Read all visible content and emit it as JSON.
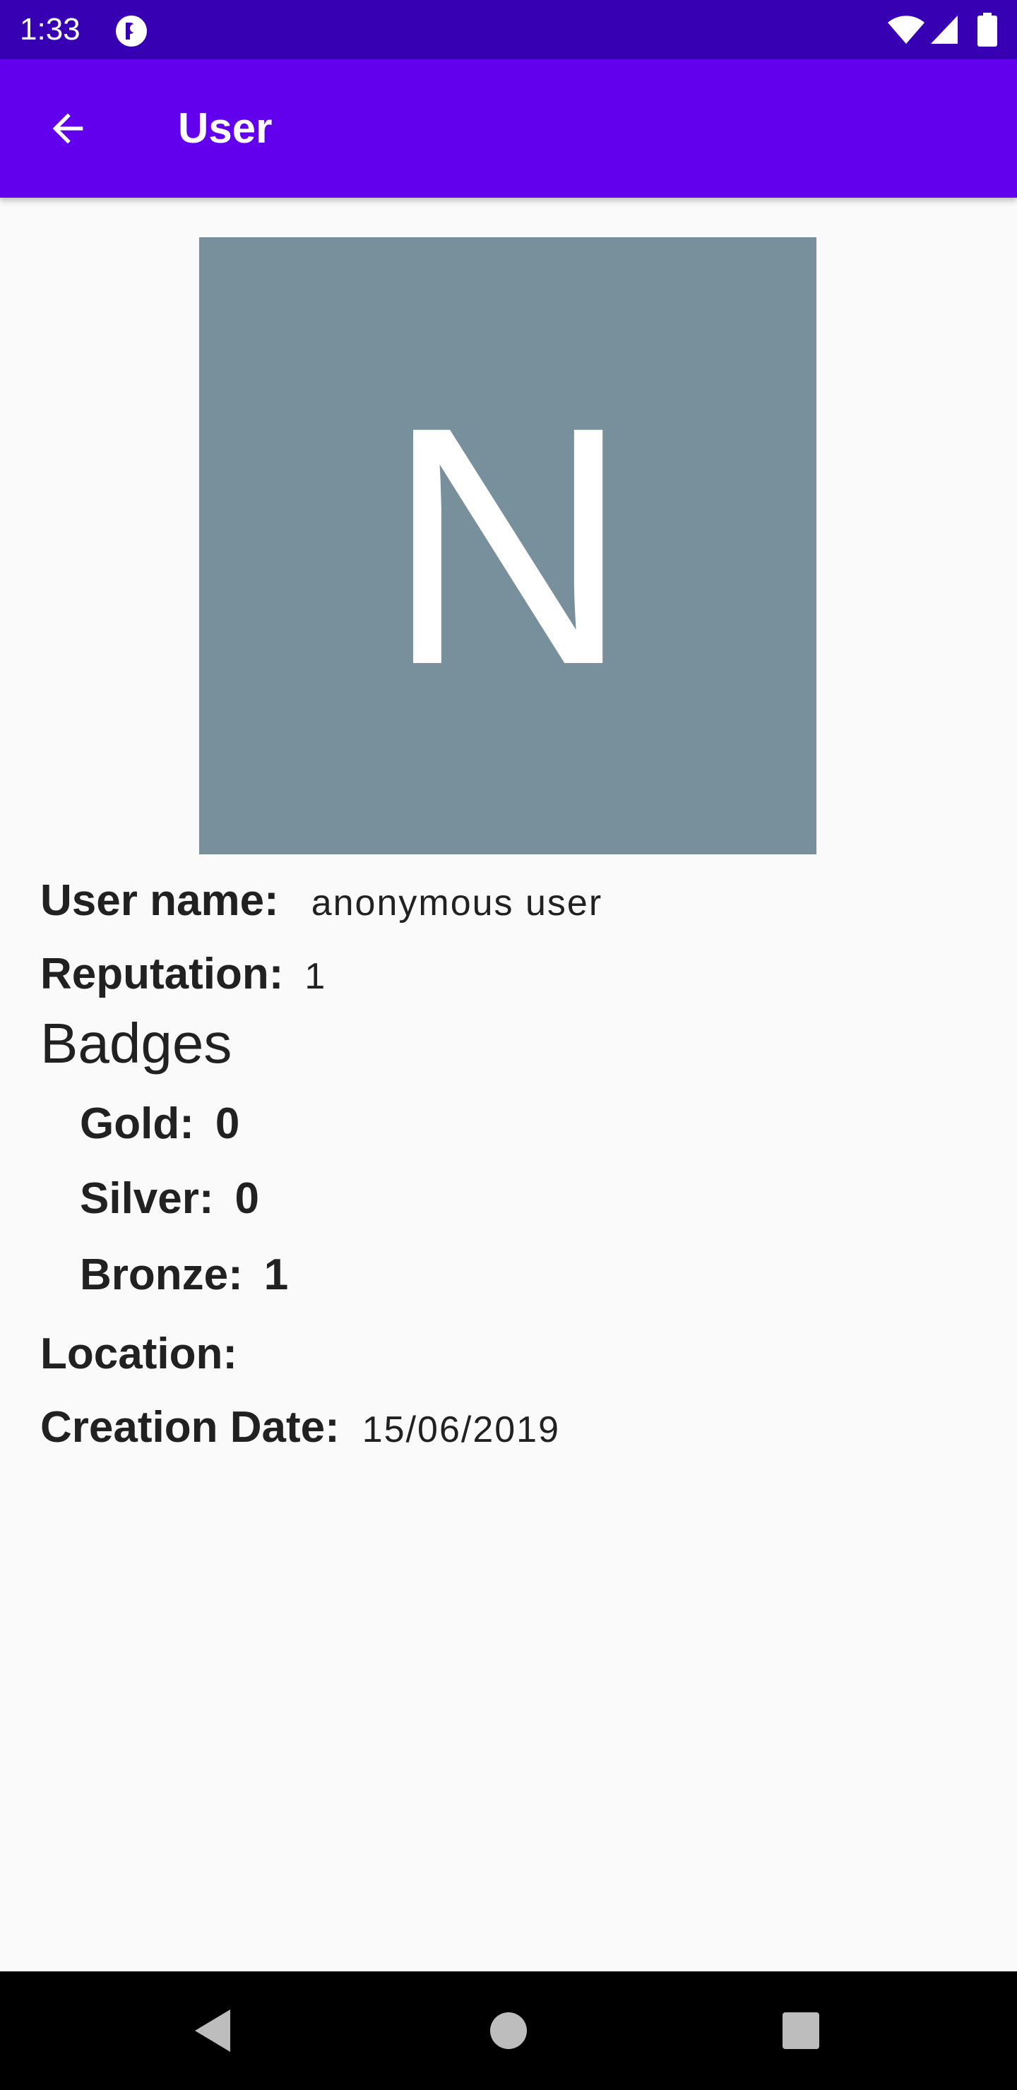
{
  "status_bar": {
    "time": "1:33",
    "icons": [
      "app-notification-icon",
      "wifi-icon",
      "signal-icon",
      "battery-icon"
    ]
  },
  "app_bar": {
    "title": "User",
    "back_icon": "arrow-left-icon",
    "color": "#6200ee"
  },
  "avatar": {
    "letter": "N",
    "background": "#78909c"
  },
  "profile": {
    "username_label": "User name:",
    "username_value": "anonymous user",
    "reputation_label": "Reputation:",
    "reputation_value": "1",
    "badges_heading": "Badges",
    "gold_label": "Gold:",
    "gold_value": "0",
    "silver_label": "Silver:",
    "silver_value": "0",
    "bronze_label": "Bronze:",
    "bronze_value": "1",
    "location_label": "Location:",
    "location_value": "",
    "creation_label": "Creation Date:",
    "creation_value": "15/06/2019"
  },
  "nav_bar": {
    "icons": [
      "nav-back-icon",
      "nav-home-icon",
      "nav-recents-icon"
    ]
  }
}
